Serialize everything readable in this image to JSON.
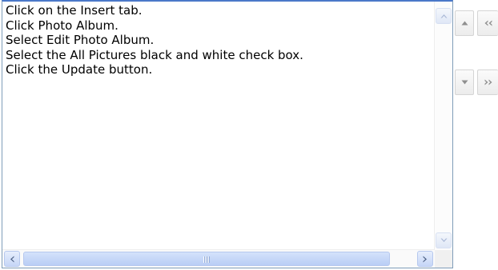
{
  "instructions": {
    "lines": [
      "Click on the Insert tab.",
      "Click Photo Album.",
      "Select Edit Photo Album.",
      "Select the All Pictures black and white check box.",
      "Click the Update button."
    ]
  },
  "icons": {
    "move_up": "triangle-up-icon",
    "move_first": "double-chevron-left-icon",
    "move_down": "triangle-down-icon",
    "move_last": "double-chevron-right-icon",
    "scroll_up": "scroll-up-arrow-icon",
    "scroll_down": "scroll-down-arrow-icon",
    "scroll_left": "scroll-left-arrow-icon",
    "scroll_right": "scroll-right-arrow-icon"
  },
  "colors": {
    "border_accent": "#4a78c9",
    "scroll_thumb": "#c6d6f7"
  }
}
